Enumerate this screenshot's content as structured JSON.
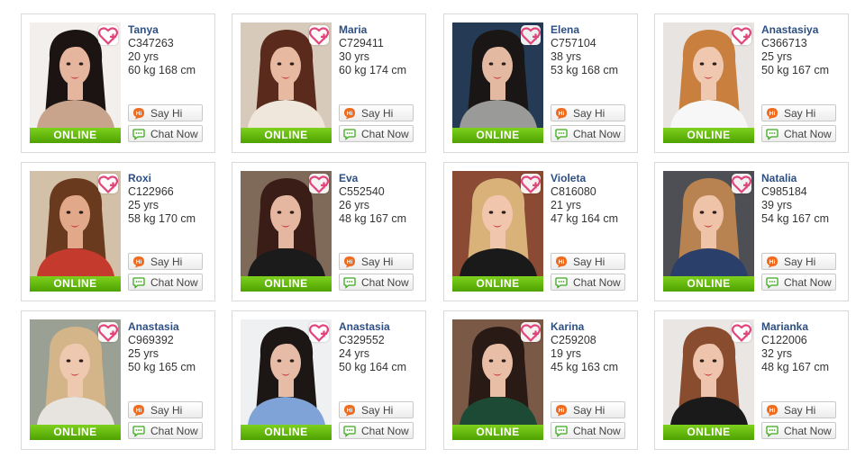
{
  "online_label": "ONLINE",
  "say_hi_label": "Say Hi",
  "chat_now_label": "Chat Now",
  "profiles": [
    {
      "name": "Tanya",
      "id": "C347263",
      "age": "20 yrs",
      "stats": "60 kg 168 cm",
      "hair": "#1b1412",
      "skin": "#e6b59d",
      "cloth": "#c9a48c",
      "bg": "#f3efec"
    },
    {
      "name": "Maria",
      "id": "C729411",
      "age": "30 yrs",
      "stats": "60 kg 174 cm",
      "hair": "#5a2a1c",
      "skin": "#e7b9a0",
      "cloth": "#efe6dc",
      "bg": "#d8cabb"
    },
    {
      "name": "Elena",
      "id": "C757104",
      "age": "38 yrs",
      "stats": "53 kg 168 cm",
      "hair": "#1a1616",
      "skin": "#e3b9a2",
      "cloth": "#9a9b98",
      "bg": "#243a55"
    },
    {
      "name": "Anastasiya",
      "id": "C366713",
      "age": "25 yrs",
      "stats": "50 kg 167 cm",
      "hair": "#c9803f",
      "skin": "#f0c8b0",
      "cloth": "#f7f7f7",
      "bg": "#e8e4e1"
    },
    {
      "name": "Roxi",
      "id": "C122966",
      "age": "25 yrs",
      "stats": "58 kg 170 cm",
      "hair": "#6a3a1f",
      "skin": "#e1a98a",
      "cloth": "#c43a2c",
      "bg": "#d3c0a8"
    },
    {
      "name": "Eva",
      "id": "C552540",
      "age": "26 yrs",
      "stats": "48 kg 167 cm",
      "hair": "#3a1d16",
      "skin": "#e5b7a0",
      "cloth": "#1b1b1b",
      "bg": "#7f6a5a"
    },
    {
      "name": "Violeta",
      "id": "C816080",
      "age": "21 yrs",
      "stats": "47 kg 164 cm",
      "hair": "#d9b27a",
      "skin": "#f0c7ad",
      "cloth": "#1a1a1a",
      "bg": "#8a4a33"
    },
    {
      "name": "Natalia",
      "id": "C985184",
      "age": "39 yrs",
      "stats": "54 kg 167 cm",
      "hair": "#b88350",
      "skin": "#eec3a8",
      "cloth": "#2a3f6a",
      "bg": "#4d4f55"
    },
    {
      "name": "Anastasia",
      "id": "C969392",
      "age": "25 yrs",
      "stats": "50 kg 165 cm",
      "hair": "#d4b58a",
      "skin": "#efc8b0",
      "cloth": "#e7e3df",
      "bg": "#9aa194"
    },
    {
      "name": "Anastasia",
      "id": "C329552",
      "age": "24 yrs",
      "stats": "50 kg 164 cm",
      "hair": "#1c1615",
      "skin": "#e6bca6",
      "cloth": "#7fa3d6",
      "bg": "#eef0f2"
    },
    {
      "name": "Karina",
      "id": "C259208",
      "age": "19 yrs",
      "stats": "45 kg 163 cm",
      "hair": "#2a1a16",
      "skin": "#e9bea7",
      "cloth": "#1d4a35",
      "bg": "#7a5946"
    },
    {
      "name": "Marianka",
      "id": "C122006",
      "age": "32 yrs",
      "stats": "48 kg 167 cm",
      "hair": "#8a4c2e",
      "skin": "#efc4ad",
      "cloth": "#1a1a1a",
      "bg": "#e9e6e4"
    }
  ]
}
